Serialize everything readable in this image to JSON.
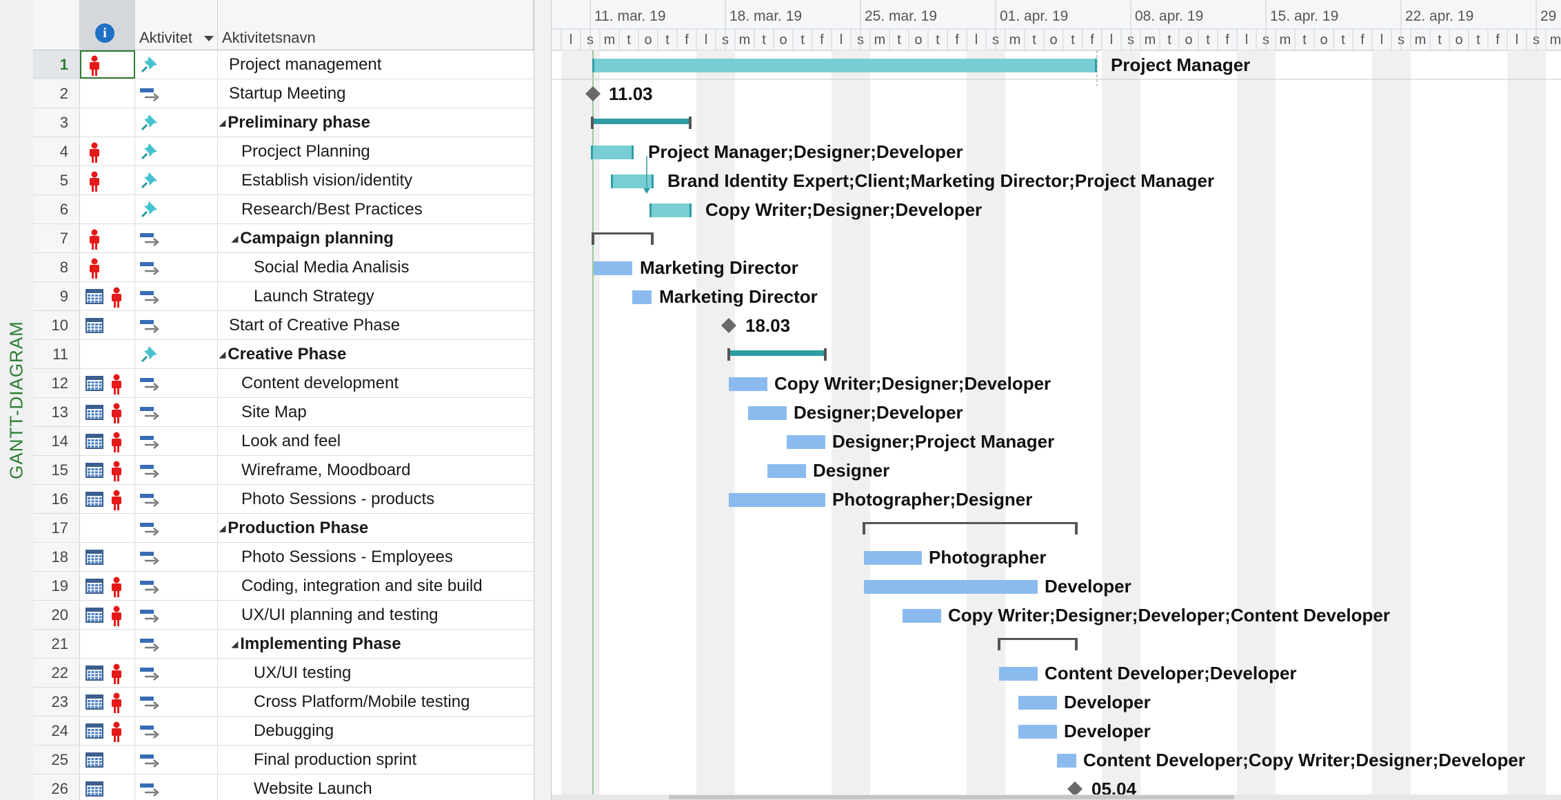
{
  "sidebar": {
    "view_label": "GANTT-DIAGRAM"
  },
  "columns": {
    "indicator_header": "i",
    "mode": "Aktivitet",
    "name": "Aktivitetsnavn"
  },
  "timescale": {
    "weeks": [
      "11. mar. 19",
      "18. mar. 19",
      "25. mar. 19",
      "01. apr. 19",
      "08. apr. 19",
      "15. apr. 19",
      "22. apr. 19",
      "29"
    ],
    "day_letters": [
      "l",
      "s",
      "m",
      "t",
      "o",
      "t",
      "f"
    ]
  },
  "colors": {
    "manual_bar": "#79ced3",
    "auto_bar": "#8bbbee",
    "summary_bar": "#2c9ea4",
    "milestone": "#6a6a6a",
    "person": "#e51919",
    "nonworking": "#f0f0f0"
  },
  "tasks": [
    {
      "id": "1",
      "name": "Project management",
      "indent": 0,
      "summary": false,
      "resource_icon": true,
      "calendar_icon": false,
      "mode": "manual",
      "resources": "Project Manager"
    },
    {
      "id": "2",
      "name": "Startup Meeting",
      "indent": 0,
      "summary": false,
      "resource_icon": false,
      "calendar_icon": false,
      "mode": "auto",
      "resources": "11.03"
    },
    {
      "id": "3",
      "name": "Preliminary phase",
      "indent": 0,
      "summary": true,
      "resource_icon": false,
      "calendar_icon": false,
      "mode": "manual",
      "resources": ""
    },
    {
      "id": "4",
      "name": "Procject Planning",
      "indent": 1,
      "summary": false,
      "resource_icon": true,
      "calendar_icon": false,
      "mode": "manual",
      "resources": "Project Manager;Designer;Developer"
    },
    {
      "id": "5",
      "name": "Establish vision/identity",
      "indent": 1,
      "summary": false,
      "resource_icon": true,
      "calendar_icon": false,
      "mode": "manual",
      "resources": "Brand Identity Expert;Client;Marketing Director;Project Manager"
    },
    {
      "id": "6",
      "name": "Research/Best Practices",
      "indent": 1,
      "summary": false,
      "resource_icon": false,
      "calendar_icon": false,
      "mode": "manual",
      "resources": "Copy Writer;Designer;Developer"
    },
    {
      "id": "7",
      "name": "Campaign planning",
      "indent": 1,
      "summary": true,
      "resource_icon": true,
      "calendar_icon": false,
      "mode": "auto",
      "resources": ""
    },
    {
      "id": "8",
      "name": "Social Media Analisis",
      "indent": 2,
      "summary": false,
      "resource_icon": true,
      "calendar_icon": false,
      "mode": "auto",
      "resources": "Marketing Director"
    },
    {
      "id": "9",
      "name": "Launch Strategy",
      "indent": 2,
      "summary": false,
      "resource_icon": true,
      "calendar_icon": true,
      "mode": "auto",
      "resources": "Marketing Director"
    },
    {
      "id": "10",
      "name": "Start of Creative Phase",
      "indent": 0,
      "summary": false,
      "resource_icon": false,
      "calendar_icon": true,
      "mode": "auto",
      "resources": "18.03"
    },
    {
      "id": "11",
      "name": "Creative Phase",
      "indent": 0,
      "summary": true,
      "resource_icon": false,
      "calendar_icon": false,
      "mode": "manual",
      "resources": ""
    },
    {
      "id": "12",
      "name": "Content development",
      "indent": 1,
      "summary": false,
      "resource_icon": true,
      "calendar_icon": true,
      "mode": "auto",
      "resources": "Copy Writer;Designer;Developer"
    },
    {
      "id": "13",
      "name": "Site Map",
      "indent": 1,
      "summary": false,
      "resource_icon": true,
      "calendar_icon": true,
      "mode": "auto",
      "resources": "Designer;Developer"
    },
    {
      "id": "14",
      "name": "Look and feel",
      "indent": 1,
      "summary": false,
      "resource_icon": true,
      "calendar_icon": true,
      "mode": "auto",
      "resources": "Designer;Project Manager"
    },
    {
      "id": "15",
      "name": "Wireframe, Moodboard",
      "indent": 1,
      "summary": false,
      "resource_icon": true,
      "calendar_icon": true,
      "mode": "auto",
      "resources": "Designer"
    },
    {
      "id": "16",
      "name": "Photo Sessions - products",
      "indent": 1,
      "summary": false,
      "resource_icon": true,
      "calendar_icon": true,
      "mode": "auto",
      "resources": "Photographer;Designer"
    },
    {
      "id": "17",
      "name": "Production Phase",
      "indent": 0,
      "summary": true,
      "resource_icon": false,
      "calendar_icon": false,
      "mode": "auto",
      "resources": ""
    },
    {
      "id": "18",
      "name": "Photo Sessions - Employees",
      "indent": 1,
      "summary": false,
      "resource_icon": false,
      "calendar_icon": true,
      "mode": "auto",
      "resources": "Photographer"
    },
    {
      "id": "19",
      "name": "Coding, integration and site build",
      "indent": 1,
      "summary": false,
      "resource_icon": true,
      "calendar_icon": true,
      "mode": "auto",
      "resources": "Developer"
    },
    {
      "id": "20",
      "name": "UX/UI planning and testing",
      "indent": 1,
      "summary": false,
      "resource_icon": true,
      "calendar_icon": true,
      "mode": "auto",
      "resources": "Copy Writer;Designer;Developer;Content Developer"
    },
    {
      "id": "21",
      "name": "Implementing Phase",
      "indent": 1,
      "summary": true,
      "resource_icon": false,
      "calendar_icon": false,
      "mode": "auto",
      "resources": ""
    },
    {
      "id": "22",
      "name": "UX/UI testing",
      "indent": 2,
      "summary": false,
      "resource_icon": true,
      "calendar_icon": true,
      "mode": "auto",
      "resources": "Content Developer;Developer"
    },
    {
      "id": "23",
      "name": "Cross Platform/Mobile testing",
      "indent": 2,
      "summary": false,
      "resource_icon": true,
      "calendar_icon": true,
      "mode": "auto",
      "resources": "Developer"
    },
    {
      "id": "24",
      "name": "Debugging",
      "indent": 2,
      "summary": false,
      "resource_icon": true,
      "calendar_icon": true,
      "mode": "auto",
      "resources": "Developer"
    },
    {
      "id": "25",
      "name": "Final production sprint",
      "indent": 2,
      "summary": false,
      "resource_icon": false,
      "calendar_icon": true,
      "mode": "auto",
      "resources": "Content Developer;Copy Writer;Designer;Developer"
    },
    {
      "id": "26",
      "name": "Website Launch",
      "indent": 2,
      "summary": false,
      "resource_icon": false,
      "calendar_icon": true,
      "mode": "auto",
      "resources": "05.04"
    }
  ]
}
